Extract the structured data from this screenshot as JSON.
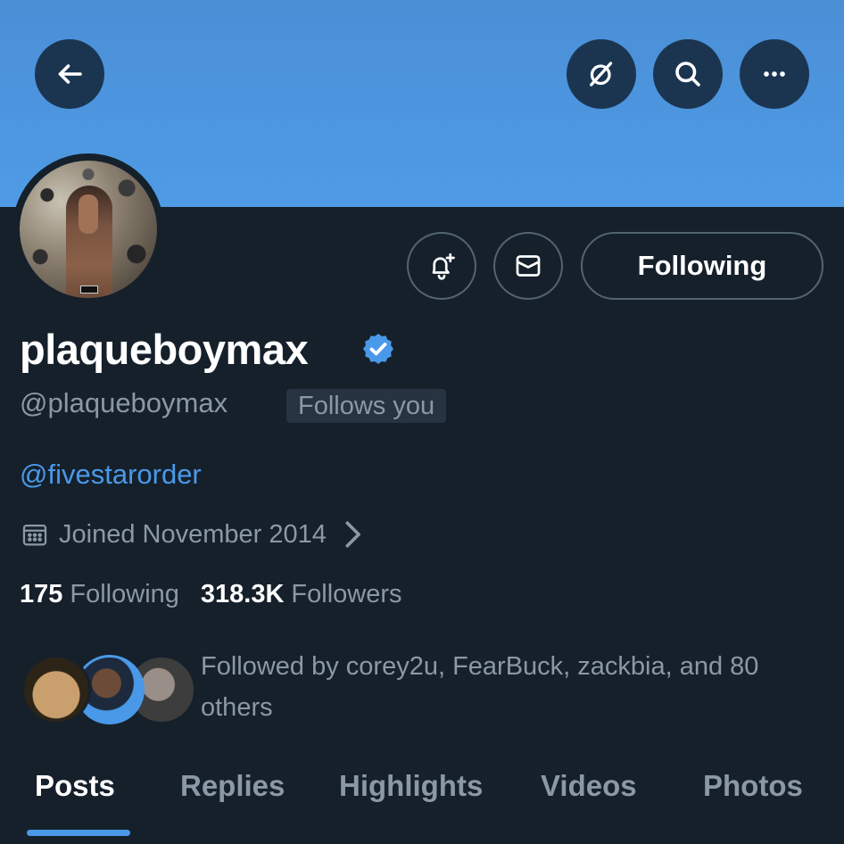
{
  "colors": {
    "accent": "#4a99e9",
    "background": "#15202b",
    "banner": "#4f9be6",
    "muted": "#8b98a5"
  },
  "header": {
    "back_icon": "arrow-left-icon",
    "grok_icon": "slash-circle-icon",
    "search_icon": "search-icon",
    "more_icon": "more-horizontal-icon"
  },
  "actions": {
    "notify_icon": "bell-plus-icon",
    "message_icon": "mail-icon",
    "follow_button_label": "Following"
  },
  "profile": {
    "display_name": "plaqueboymax",
    "verified": true,
    "handle": "@plaqueboymax",
    "follows_you": "Follows you",
    "bio": "@fivestarorder",
    "joined": "Joined November 2014",
    "following_count": "175",
    "following_label": "Following",
    "followers_count": "318.3K",
    "followers_label": "Followers",
    "followed_by": "Followed by corey2u, FearBuck, zackbia, and 80 others"
  },
  "tabs": [
    {
      "label": "Posts",
      "active": true
    },
    {
      "label": "Replies",
      "active": false
    },
    {
      "label": "Highlights",
      "active": false
    },
    {
      "label": "Videos",
      "active": false
    },
    {
      "label": "Photos",
      "active": false
    }
  ]
}
